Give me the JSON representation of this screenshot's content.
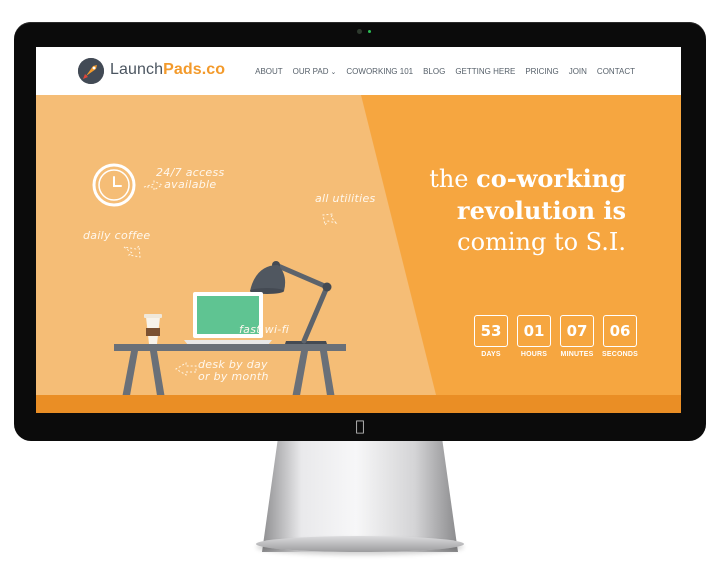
{
  "brand": {
    "name_prefix": "Launch",
    "name_suffix": "Pads.co",
    "accent_color": "#f39a2b"
  },
  "nav": {
    "items": [
      {
        "label": "ABOUT"
      },
      {
        "label": "OUR PAD",
        "has_dropdown": true
      },
      {
        "label": "COWORKING 101"
      },
      {
        "label": "BLOG"
      },
      {
        "label": "GETTING HERE"
      },
      {
        "label": "PRICING"
      },
      {
        "label": "JOIN"
      },
      {
        "label": "CONTACT"
      }
    ]
  },
  "hero": {
    "annotations": {
      "access_line1": "24/7 access",
      "access_line2": "available",
      "utilities": "all utilities",
      "coffee": "daily coffee",
      "wifi": "fast wi-fi",
      "desk_line1": "desk by day",
      "desk_line2": "or by month"
    },
    "headline": {
      "line1_light": "the ",
      "line1_bold": "co-working",
      "line2_bold": "revolution is",
      "line3": "coming to S.I."
    },
    "countdown": [
      {
        "value": "53",
        "label": "DAYS"
      },
      {
        "value": "01",
        "label": "HOURS"
      },
      {
        "value": "07",
        "label": "MINUTES"
      },
      {
        "value": "06",
        "label": "SECONDS"
      }
    ]
  },
  "icons": {
    "clock": "clock-icon",
    "lamp": "desk-lamp-icon",
    "laptop": "laptop-icon",
    "coffee": "coffee-cup-icon",
    "rocket": "rocket-logo-icon",
    "apple": "apple-logo-icon"
  }
}
